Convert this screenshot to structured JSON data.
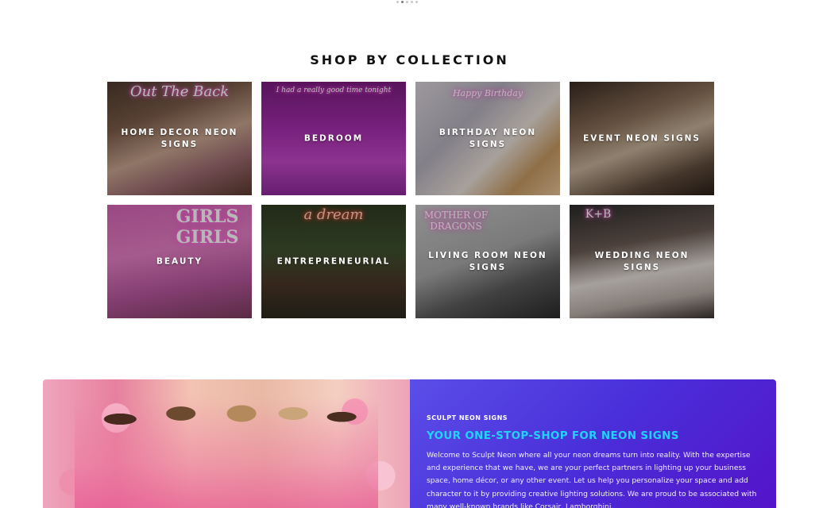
{
  "carousel": {
    "dots": 5,
    "active_index": 1
  },
  "collection": {
    "title": "SHOP BY COLLECTION",
    "tiles": [
      {
        "label": "HOME DECOR NEON SIGNS",
        "neon_text": "Out The Back"
      },
      {
        "label": "BEDROOM",
        "neon_text": "I had a really good time tonight"
      },
      {
        "label": "BIRTHDAY NEON SIGNS",
        "neon_text": "Happy Birthday"
      },
      {
        "label": "EVENT NEON SIGNS",
        "neon_text": ""
      },
      {
        "label": "BEAUTY",
        "neon_text": "GIRLS GIRLS"
      },
      {
        "label": "ENTREPRENEURIAL",
        "neon_text": "a dream"
      },
      {
        "label": "LIVING ROOM NEON SIGNS",
        "neon_text": "MOTHER OF DRAGONS"
      },
      {
        "label": "WEDDING NEON SIGNS",
        "neon_text": "K+B"
      }
    ]
  },
  "promo": {
    "eyebrow": "SCULPT NEON SIGNS",
    "headline": "YOUR ONE-STOP-SHOP FOR NEON SIGNS",
    "body": "Welcome to Sculpt Neon where all your neon dreams turn into reality. With the expertise and experience that we have, we are your perfect partners in lighting up your business space, home décor, or any other event. Let us help you personalize your space and add character to it by providing creative lighting solutions. We are proud to be associated with many well-known brands like Corsair, Lamborghini,"
  },
  "colors": {
    "accent": "#20d4ff",
    "promo_bg_start": "#5a4ee8",
    "promo_bg_end": "#5414c9"
  }
}
